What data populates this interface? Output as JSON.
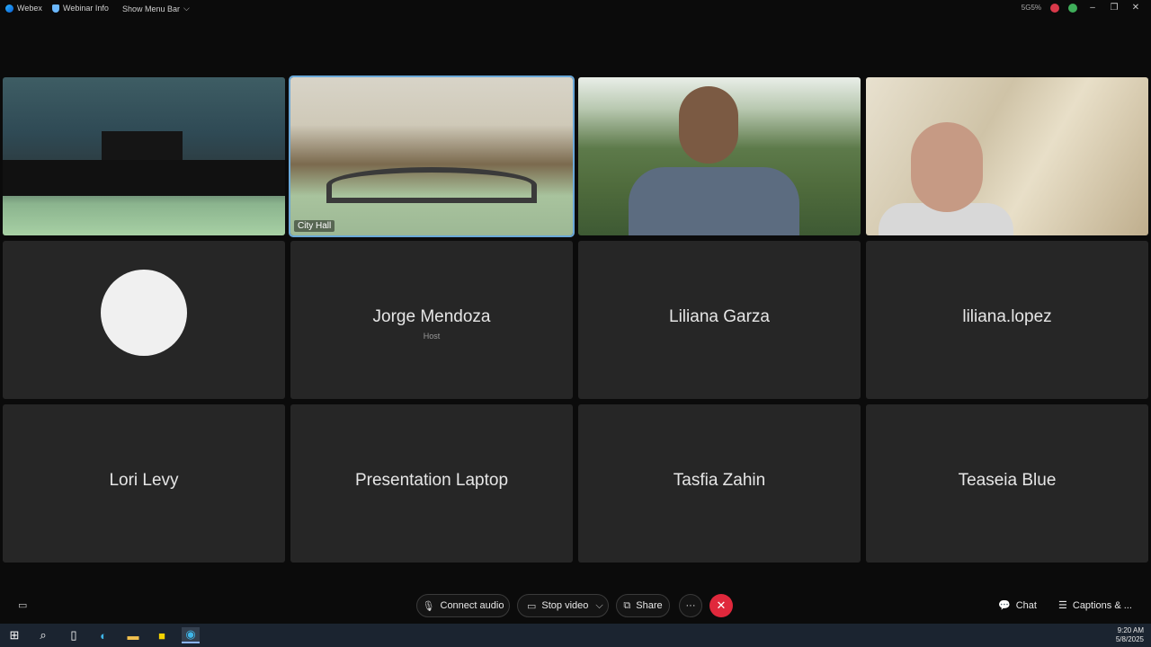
{
  "titlebar": {
    "app_name": "Webex",
    "webinar_info": "Webinar Info",
    "show_menu_bar": "Show Menu Bar",
    "status_text": "5G5%",
    "window_controls": [
      "–",
      "❐",
      "✕"
    ]
  },
  "video_tiles": [
    {
      "label": ""
    },
    {
      "label": "City Hall"
    },
    {
      "label": ""
    },
    {
      "label": ""
    }
  ],
  "participants": [
    {
      "name": "",
      "role": ""
    },
    {
      "name": "Jorge Mendoza",
      "role": "Host"
    },
    {
      "name": "Liliana Garza",
      "role": ""
    },
    {
      "name": "liliana.lopez",
      "role": ""
    },
    {
      "name": "Lori Levy",
      "role": ""
    },
    {
      "name": "Presentation Laptop",
      "role": ""
    },
    {
      "name": "Tasfia Zahin",
      "role": ""
    },
    {
      "name": "Teaseia Blue",
      "role": ""
    }
  ],
  "toolbar": {
    "connect_audio": "Connect audio",
    "stop_video": "Stop video",
    "share": "Share",
    "more": "···",
    "end": "✕",
    "chat": "Chat",
    "captions": "Captions & ..."
  },
  "taskbar": {
    "time": "9:20 AM",
    "date": "5/8/2025"
  },
  "colors": {
    "end_button": "#e0283c",
    "active_outline": "#6aa8d8",
    "tile_bg": "#262626"
  }
}
